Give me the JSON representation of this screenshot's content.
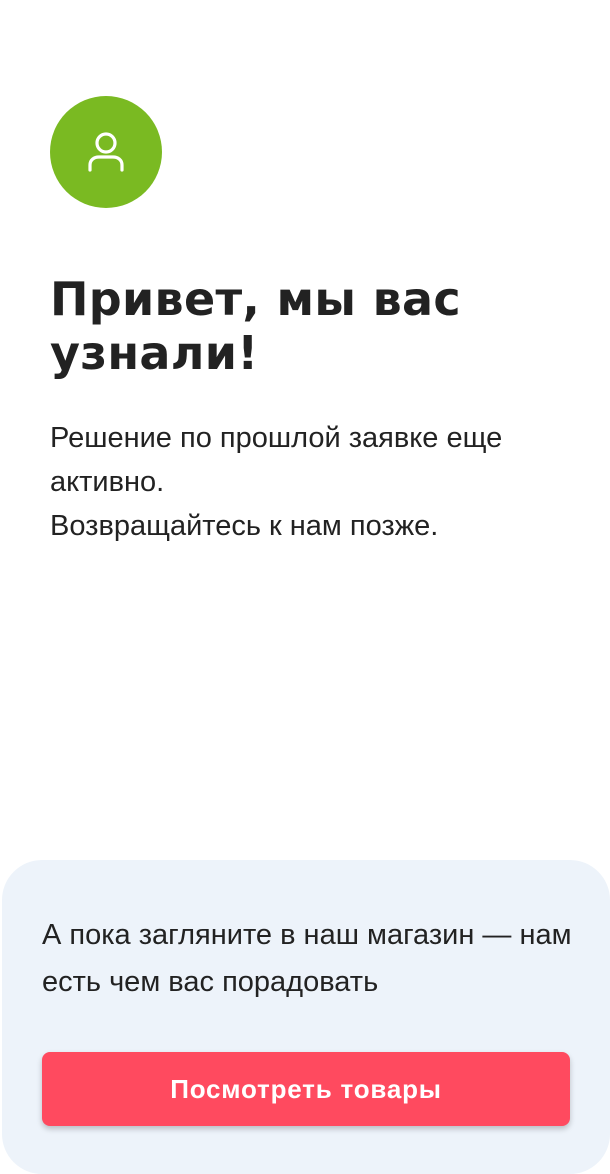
{
  "header": {
    "avatar_icon": "user-icon",
    "avatar_color": "#7aba22"
  },
  "main": {
    "title": "Привет, мы вас узнали!",
    "message_lines": [
      "Решение по прошлой заявке еще активно.",
      "Возвращайтесь к нам позже."
    ]
  },
  "promo": {
    "text": "А пока загляните в наш магазин — нам есть чем вас порадовать",
    "button_label": "Посмотреть товары",
    "button_color": "#ff4a5f",
    "background_color": "#edf3fa"
  }
}
